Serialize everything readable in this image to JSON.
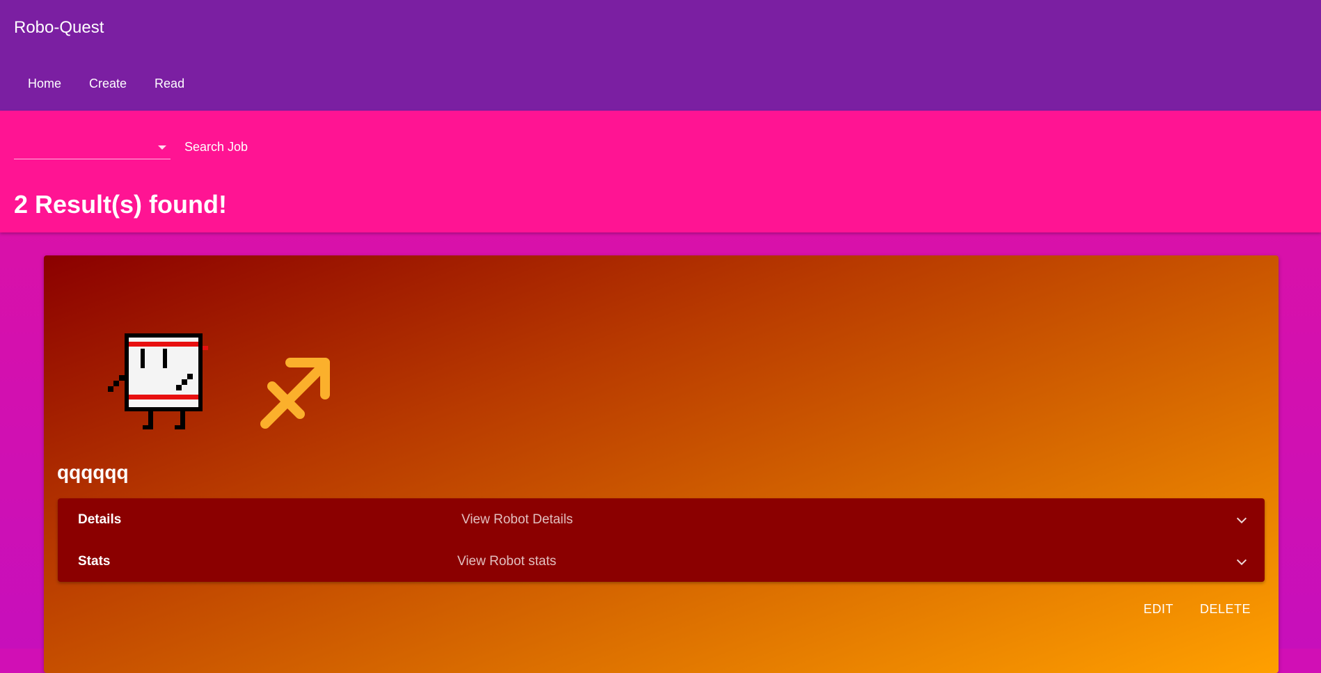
{
  "app": {
    "title": "Robo-Quest"
  },
  "nav": {
    "items": [
      "Home",
      "Create",
      "Read"
    ]
  },
  "search": {
    "selected_job": "",
    "button_label": "Search Job"
  },
  "results": {
    "title": "2 Result(s) found!"
  },
  "card": {
    "name": "qqqqqq",
    "zodiac_icon": "sagittarius-icon",
    "panels": [
      {
        "title": "Details",
        "subtitle": "View Robot Details"
      },
      {
        "title": "Stats",
        "subtitle": "View Robot stats"
      }
    ],
    "actions": {
      "edit": "EDIT",
      "delete": "DELETE"
    }
  },
  "colors": {
    "header": "#7b1fa2",
    "search_band": "#ff1493",
    "card_panel": "#8b0000",
    "zodiac": "#fbb02c"
  }
}
